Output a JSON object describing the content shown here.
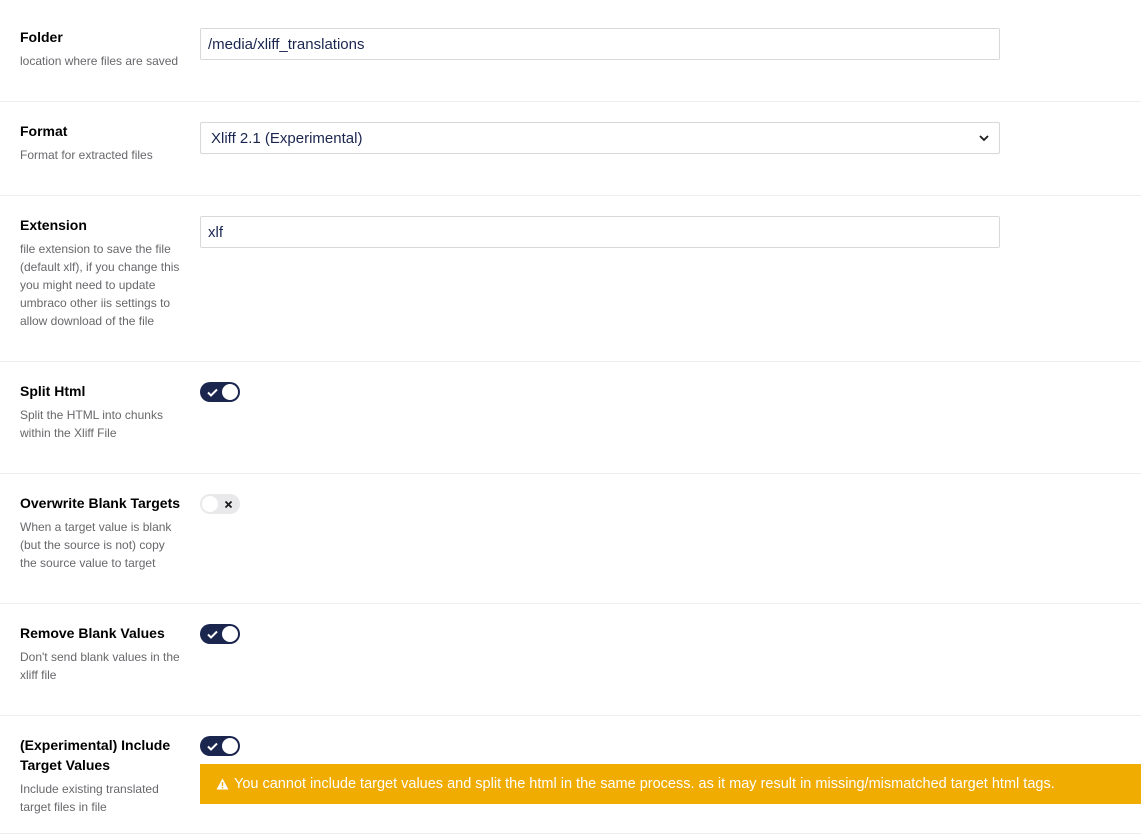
{
  "settings": {
    "folder": {
      "label": "Folder",
      "description": "location where files are saved",
      "value": "/media/xliff_translations"
    },
    "format": {
      "label": "Format",
      "description": "Format for extracted files",
      "selected": "Xliff 2.1 (Experimental)"
    },
    "extension": {
      "label": "Extension",
      "description": "file extension to save the file (default xlf), if you change this you might need to update umbraco other iis settings to allow download of the file",
      "value": "xlf"
    },
    "split_html": {
      "label": "Split Html",
      "description": "Split the HTML into chunks within the Xliff File",
      "enabled": true
    },
    "overwrite_blank_targets": {
      "label": "Overwrite Blank Targets",
      "description": "When a target value is blank (but the source is not) copy the source value to target",
      "enabled": false
    },
    "remove_blank_values": {
      "label": "Remove Blank Values",
      "description": "Don't send blank values in the xliff file",
      "enabled": true
    },
    "include_target_values": {
      "label": "(Experimental) Include Target Values",
      "description": "Include existing translated target files in file",
      "enabled": true,
      "warning": "You cannot include target values and split the html in the same process. as it may result in missing/mismatched target html tags."
    }
  },
  "colors": {
    "toggle_on": "#1b264f",
    "toggle_off": "#e9e9eb",
    "warning": "#f0ac00",
    "label": "#000000",
    "description": "#68676b"
  },
  "icons": {
    "toggle_on_mark": "check-icon",
    "toggle_off_mark": "close-icon",
    "select_arrow": "chevron-down-icon",
    "warning": "warning-icon"
  }
}
